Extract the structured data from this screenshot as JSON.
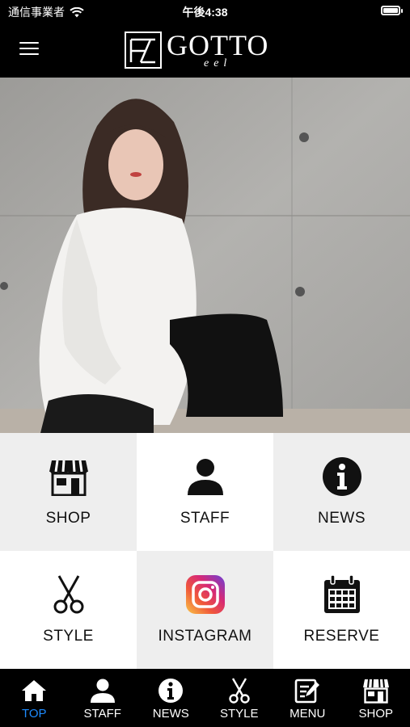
{
  "status_bar": {
    "carrier": "通信事業者",
    "time": "午後4:38"
  },
  "header": {
    "logo_name": "GOTTO",
    "logo_sub": "eel",
    "menu_icon": "hamburger-icon"
  },
  "hero": {
    "image": "salon-model-photo"
  },
  "grid": [
    {
      "label": "SHOP",
      "icon": "shop-icon"
    },
    {
      "label": "STAFF",
      "icon": "person-icon"
    },
    {
      "label": "NEWS",
      "icon": "info-icon"
    },
    {
      "label": "STYLE",
      "icon": "scissors-icon"
    },
    {
      "label": "INSTAGRAM",
      "icon": "instagram-icon"
    },
    {
      "label": "RESERVE",
      "icon": "calendar-icon"
    }
  ],
  "tabs": [
    {
      "label": "TOP",
      "icon": "home-icon",
      "active": true
    },
    {
      "label": "STAFF",
      "icon": "person-icon"
    },
    {
      "label": "NEWS",
      "icon": "info-icon"
    },
    {
      "label": "STYLE",
      "icon": "scissors-icon"
    },
    {
      "label": "MENU",
      "icon": "menu-edit-icon"
    },
    {
      "label": "SHOP",
      "icon": "shop-icon"
    }
  ],
  "colors": {
    "active_tab": "#1e8bff",
    "bar_bg": "#000000",
    "tile_grey": "#eeeeee"
  }
}
